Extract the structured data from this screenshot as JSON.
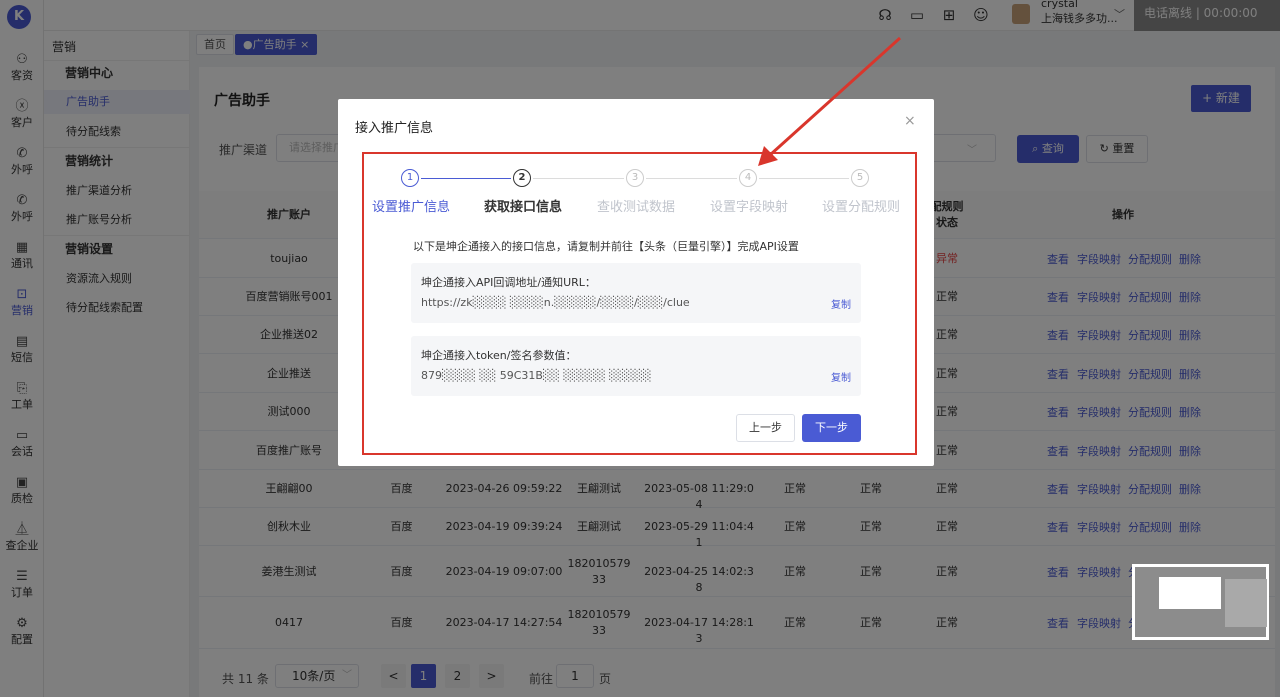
{
  "rail": {
    "logo": "K",
    "items": [
      {
        "label": "客资",
        "icon": "user-icon",
        "glyph": "⚇"
      },
      {
        "label": "客户",
        "icon": "person-icon",
        "glyph": "ⓧ"
      },
      {
        "label": "外呼",
        "icon": "phone-icon",
        "glyph": "✆"
      },
      {
        "label": "外呼",
        "icon": "phone-out-icon",
        "glyph": "✆"
      },
      {
        "label": "通讯",
        "icon": "contacts-icon",
        "glyph": "▦"
      },
      {
        "label": "营销",
        "icon": "marketing-icon",
        "glyph": "⊡"
      },
      {
        "label": "短信",
        "icon": "sms-icon",
        "glyph": "▤"
      },
      {
        "label": "工单",
        "icon": "ticket-icon",
        "glyph": "⎘"
      },
      {
        "label": "会话",
        "icon": "chat-icon",
        "glyph": "▭"
      },
      {
        "label": "质检",
        "icon": "quality-icon",
        "glyph": "▣"
      },
      {
        "label": "查企业",
        "icon": "enterprise-icon",
        "glyph": "⏅"
      },
      {
        "label": "订单",
        "icon": "order-icon",
        "glyph": "☰"
      },
      {
        "label": "配置",
        "icon": "settings-icon",
        "glyph": "⚙"
      }
    ]
  },
  "header": {
    "icons": [
      {
        "name": "headset-icon",
        "glyph": "☊"
      },
      {
        "name": "monitor-icon",
        "glyph": "▭"
      },
      {
        "name": "book-icon",
        "glyph": "⊞"
      },
      {
        "name": "message-icon",
        "glyph": "☺"
      }
    ],
    "user_name": "crystal",
    "user_company": "上海钱多多功...",
    "chevron": "﹀",
    "phone_status": "电话离线 |    00:00:00"
  },
  "submenu": {
    "title": "营销",
    "groups": [
      {
        "label": "营销中心"
      },
      {
        "label": "广告助手"
      },
      {
        "label": "待分配线索"
      },
      {
        "label": "营销统计"
      },
      {
        "label": "推广渠道分析"
      },
      {
        "label": "推广账号分析"
      },
      {
        "label": "营销设置"
      },
      {
        "label": "资源流入规则"
      },
      {
        "label": "待分配线索配置"
      }
    ]
  },
  "tabs": [
    {
      "label": "首页"
    },
    {
      "label": "●广告助手 ×"
    }
  ],
  "page": {
    "title": "广告助手",
    "new_button": "+ 新建",
    "filter_label": "推广渠道",
    "filter_placeholder": "请选择推广",
    "query_button": "⌕ 查询",
    "reset_button": "↻ 重置"
  },
  "table": {
    "headers": {
      "account": "推广账户",
      "rule_status": "配规则状态",
      "ops": "操作"
    },
    "ops": [
      "查看",
      "字段映射",
      "分配规则",
      "删除"
    ],
    "rows": [
      {
        "account": "toujiao",
        "channel": "",
        "created": "",
        "creator": "",
        "updated": "",
        "s1": "",
        "s2": "",
        "s3": "异常"
      },
      {
        "account": "百度营销账号001",
        "channel": "",
        "created": "",
        "creator": "",
        "updated": "",
        "s1": "",
        "s2": "",
        "s3": "正常"
      },
      {
        "account": "企业推送02",
        "channel": "",
        "created": "",
        "creator": "",
        "updated": "",
        "s1": "",
        "s2": "",
        "s3": "正常"
      },
      {
        "account": "企业推送",
        "channel": "",
        "created": "",
        "creator": "",
        "updated": "",
        "s1": "",
        "s2": "",
        "s3": "正常"
      },
      {
        "account": "测试000",
        "channel": "",
        "created": "",
        "creator": "",
        "updated": "",
        "s1": "",
        "s2": "",
        "s3": "正常"
      },
      {
        "account": "百度推广账号",
        "channel": "",
        "created": "",
        "creator": "",
        "updated": "",
        "s1": "",
        "s2": "",
        "s3": "正常"
      },
      {
        "account": "王翩翩00",
        "channel": "百度",
        "created": "2023-04-26 09:59:22",
        "creator": "王翩测试",
        "updated": "2023-05-08 11:29:04",
        "s1": "正常",
        "s2": "正常",
        "s3": "正常"
      },
      {
        "account": "创秋木业",
        "channel": "百度",
        "created": "2023-04-19 09:39:24",
        "creator": "王翩测试",
        "updated": "2023-05-29 11:04:41",
        "s1": "正常",
        "s2": "正常",
        "s3": "正常"
      },
      {
        "account": "姜港生测试",
        "channel": "百度",
        "created": "2023-04-19 09:07:00",
        "creator": "18201057933",
        "updated": "2023-04-25 14:02:38",
        "s1": "正常",
        "s2": "正常",
        "s3": "正常"
      },
      {
        "account": "0417",
        "channel": "百度",
        "created": "2023-04-17 14:27:54",
        "creator": "18201057933",
        "updated": "2023-04-17 14:28:13",
        "s1": "正常",
        "s2": "正常",
        "s3": "正常"
      }
    ]
  },
  "pager": {
    "total": "共 11 条",
    "size": "10条/页",
    "size_chevron": "﹀",
    "prev": "<",
    "pages": [
      "1",
      "2"
    ],
    "next": ">",
    "goto": "前往",
    "goto_value": "1",
    "page_unit": "页"
  },
  "modal": {
    "title": "接入推广信息",
    "close": "×",
    "steps": [
      {
        "num": "1",
        "label": "设置推广信息",
        "state": "done"
      },
      {
        "num": "2",
        "label": "获取接口信息",
        "state": "current"
      },
      {
        "num": "3",
        "label": "查收测试数据",
        "state": "pending"
      },
      {
        "num": "4",
        "label": "设置字段映射",
        "state": "pending"
      },
      {
        "num": "5",
        "label": "设置分配规则",
        "state": "pending"
      }
    ],
    "intro": "以下是坤企通接入的接口信息，请复制并前往【头条（巨量引擎）】完成API设置",
    "callback_label": "坤企通接入API回调地址/通知URL：",
    "callback_value": "https://zk░░░░ ░░░░n.░░░░░/░░░░/░░░/clue",
    "token_label": "坤企通接入token/签名参数值：",
    "token_value": "879░░░░ ░░ 59C31B░░ ░░░░░ ░░░░░",
    "copy": "复制",
    "prev": "上一步",
    "next": "下一步"
  },
  "colors": {
    "accent": "#4a5bd4",
    "annotation": "#d9362c",
    "error": "#e64545"
  }
}
